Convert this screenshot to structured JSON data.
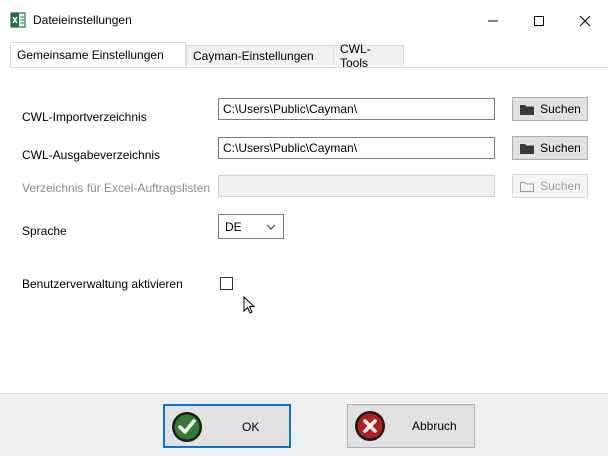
{
  "window": {
    "title": "Dateieinstellungen",
    "minimize_glyph": "—",
    "maximize_glyph": "☐",
    "close_glyph": "✕",
    "app_icon": "excel-icon"
  },
  "tabs": [
    {
      "label": "Gemeinsame Einstellungen",
      "active": true
    },
    {
      "label": "Cayman-Einstellungen",
      "active": false
    },
    {
      "label": "CWL-Tools",
      "active": false
    }
  ],
  "form": {
    "import_dir": {
      "label": "CWL-Importverzeichnis",
      "value": "C:\\Users\\Public\\Cayman\\",
      "button": "Suchen"
    },
    "export_dir": {
      "label": "CWL-Ausgabeverzeichnis",
      "value": "C:\\Users\\Public\\Cayman\\",
      "button": "Suchen"
    },
    "excel_dir": {
      "label": "Verzeichnis für Excel-Auftragslisten",
      "value": "",
      "button": "Suchen",
      "disabled": true
    },
    "language": {
      "label": "Sprache",
      "value": "DE"
    },
    "user_mgmt": {
      "label": "Benutzerverwaltung aktivieren",
      "checked": false
    }
  },
  "footer": {
    "ok_label": "OK",
    "cancel_label": "Abbruch"
  },
  "colors": {
    "focus_border": "#0078d7",
    "ok_green": "#2e7d32",
    "cancel_red": "#b71c1c"
  }
}
